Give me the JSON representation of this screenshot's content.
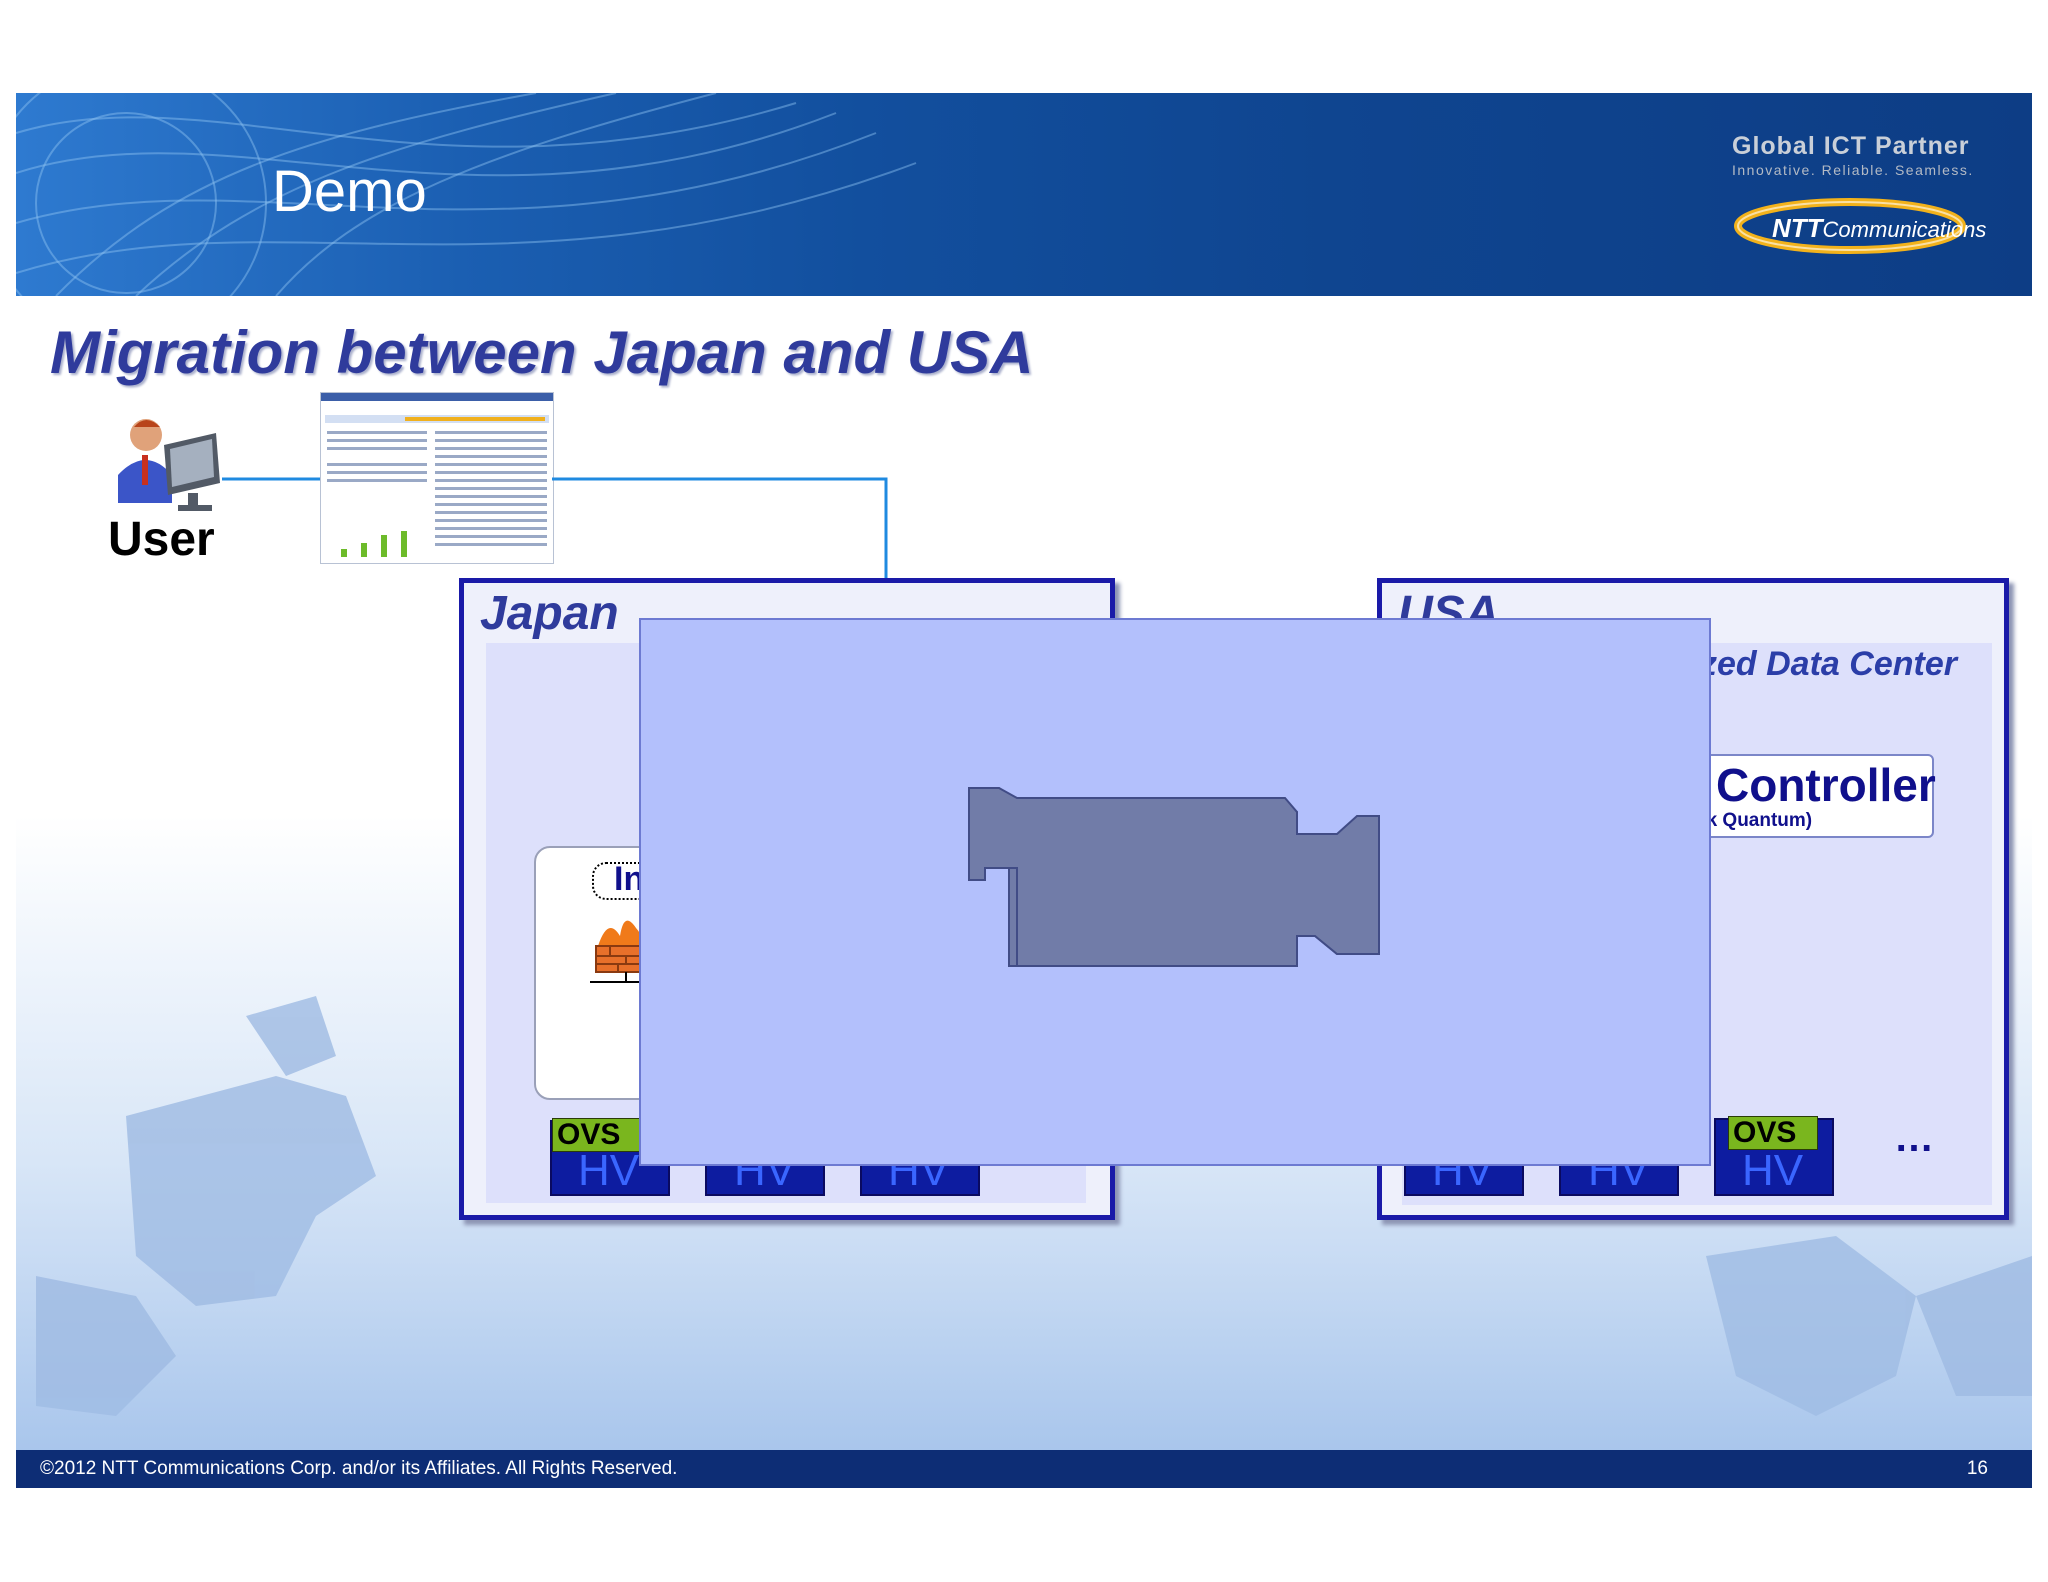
{
  "header": {
    "title": "Demo",
    "brand_tagline": "Global ICT Partner",
    "brand_sub": "Innovative. Reliable. Seamless.",
    "brand_logo_ntt": "NTT",
    "brand_logo_rest": "Communications"
  },
  "slide": {
    "subtitle": "Migration between Japan and USA",
    "user_label": "User"
  },
  "japan": {
    "label": "Japan",
    "partial_tag": "In",
    "hosts": [
      {
        "ovs": "OVS",
        "hv": "HV"
      },
      {
        "hv": "HV"
      },
      {
        "hv": "HV"
      }
    ]
  },
  "usa": {
    "label": "USA",
    "dc_label_partial": "zed Data Center",
    "controller_title": "Controller",
    "controller_sub": "ck Quantum)",
    "hosts": [
      {
        "hv": "HV"
      },
      {
        "hv": "HV"
      },
      {
        "ovs": "OVS",
        "hv": "HV"
      }
    ],
    "ellipsis": "…"
  },
  "video": {
    "icon": "video-camera-icon"
  },
  "footer": {
    "copyright": "©2012  NTT Communications Corp. and/or its Affiliates. All Rights Reserved.",
    "page_number": "16"
  },
  "colors": {
    "banner": "#124f9e",
    "footer": "#0d2d75",
    "heading": "#2f3b9c",
    "hv_fill": "#0d1ca0",
    "ovs_fill": "#7ab61e",
    "video_overlay": "#b3c0fc",
    "connector": "#1f8ae0"
  }
}
